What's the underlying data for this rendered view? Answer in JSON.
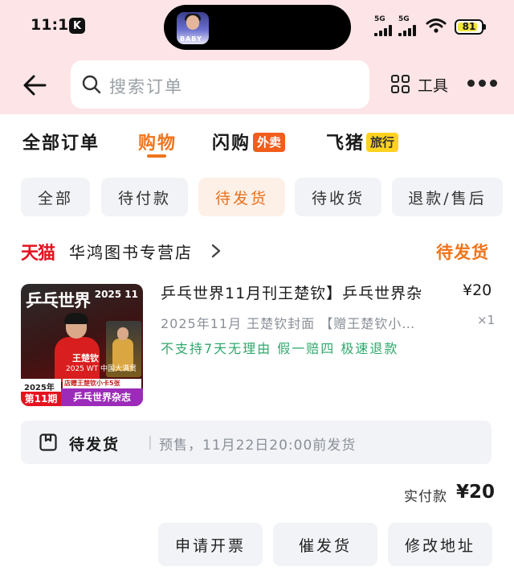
{
  "status_bar": {
    "time": "11:15",
    "app_badge": "K",
    "island_thumb_text": "BABY",
    "signal_1": "5G",
    "signal_2": "5G",
    "battery": "81"
  },
  "header": {
    "search_placeholder": "搜索订单",
    "tools_label": "工具",
    "icons": [
      "back-arrow-icon",
      "search-icon",
      "grid-icon",
      "more-icon"
    ]
  },
  "category_tabs": [
    {
      "label": "全部订单",
      "active": false
    },
    {
      "label": "购物",
      "active": true
    },
    {
      "label": "闪购",
      "badge": "外卖",
      "active": false
    },
    {
      "label": "飞猪",
      "badge": "旅行",
      "active": false
    }
  ],
  "filters": [
    {
      "label": "全部",
      "active": false
    },
    {
      "label": "待付款",
      "active": false
    },
    {
      "label": "待发货",
      "active": true
    },
    {
      "label": "待收货",
      "active": false
    },
    {
      "label": "退款/售后",
      "active": false
    }
  ],
  "order": {
    "platform": "天猫",
    "shop_name": "华鸿图书专营店",
    "status": "待发货",
    "cover": {
      "title": "乒乓世界",
      "issue": "2025 11",
      "player_name": "王楚钦",
      "subtitle": "2025 WT 中国大满贯",
      "stripe": "店赠王楚钦小卡5张",
      "year": "2025年",
      "period": "第11期",
      "brand": "乒乓世界杂志"
    },
    "title": "乒乓世界11月刊王楚钦】乒乓世界杂",
    "price": "¥20",
    "spec": "2025年11月 王楚钦封面 【赠王楚钦小…",
    "quantity": "×1",
    "service": "不支持7天无理由  假一赔四  极速退款",
    "shipping": {
      "label": "待发货",
      "text": "预售，11月22日20:00前发货"
    },
    "paid_label": "实付款",
    "paid_amount": "¥20",
    "actions": [
      "申请开票",
      "催发货",
      "修改地址"
    ]
  },
  "colors": {
    "accent": "#f0741c",
    "header_bg": "#fde4e6",
    "tmall_red": "#e5121f",
    "service_green": "#2fa86b",
    "pill_bg": "#f1f3f6"
  }
}
